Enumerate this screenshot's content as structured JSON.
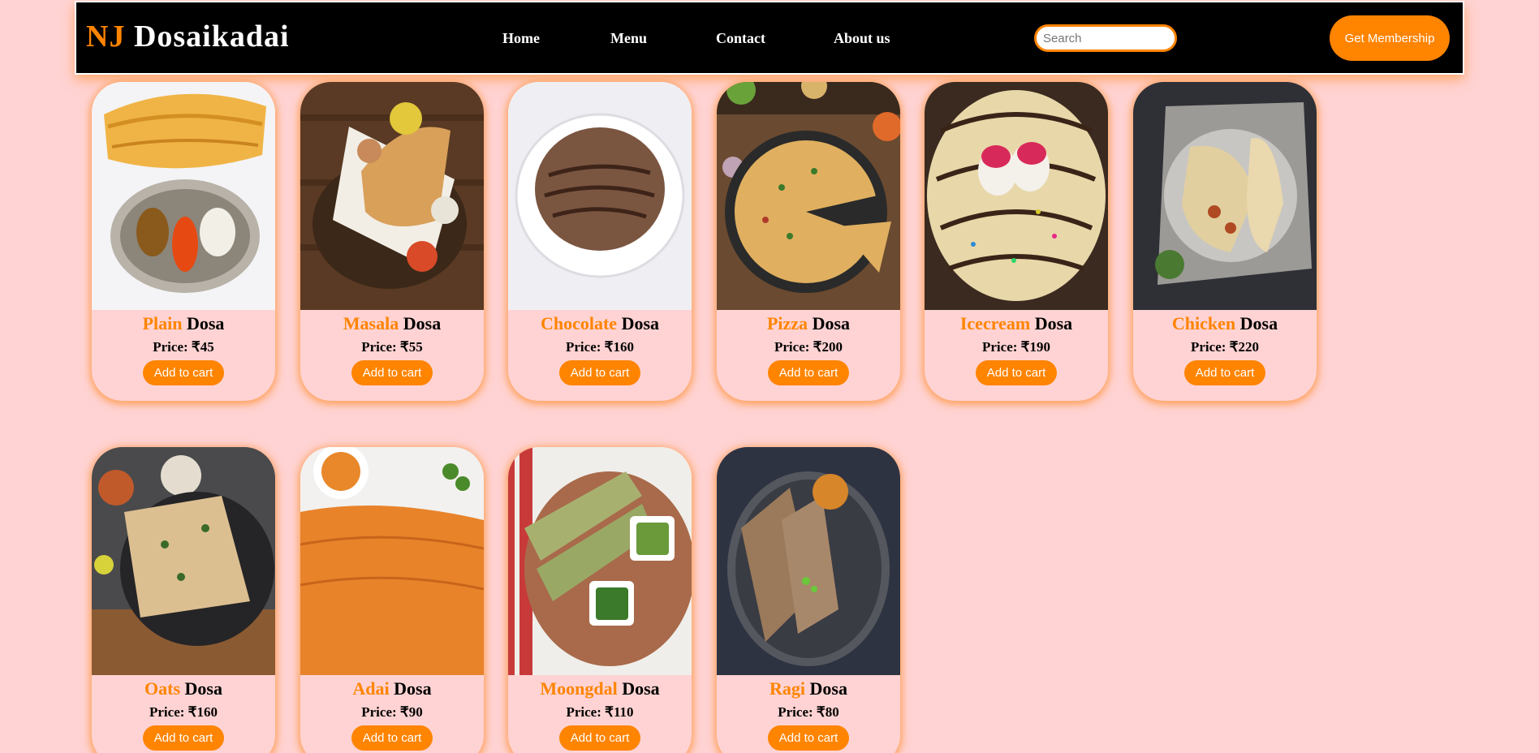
{
  "brand": {
    "prefix": "NJ",
    "name": "Dosaikadai"
  },
  "nav": {
    "home": "Home",
    "menu": "Menu",
    "contact": "Contact",
    "about": "About us"
  },
  "search": {
    "placeholder": "Search",
    "value": ""
  },
  "membership_label": "Get Membership",
  "colors": {
    "accent": "#ff8400",
    "background": "#ffd3d3",
    "navbar": "#000000"
  },
  "cards": [
    {
      "name": "Plain",
      "suffix": "Dosa",
      "price": "Price: ₹45",
      "button": "Add to cart"
    },
    {
      "name": "Masala",
      "suffix": "Dosa",
      "price": "Price: ₹55",
      "button": "Add to cart"
    },
    {
      "name": "Chocolate",
      "suffix": "Dosa",
      "price": "Price: ₹160",
      "button": "Add to cart"
    },
    {
      "name": "Pizza",
      "suffix": "Dosa",
      "price": "Price: ₹200",
      "button": "Add to cart"
    },
    {
      "name": "Icecream",
      "suffix": "Dosa",
      "price": "Price: ₹190",
      "button": "Add to cart"
    },
    {
      "name": "Chicken",
      "suffix": "Dosa",
      "price": "Price: ₹220",
      "button": "Add to cart"
    },
    {
      "name": "Oats",
      "suffix": "Dosa",
      "price": "Price: ₹160",
      "button": "Add to cart"
    },
    {
      "name": "Adai",
      "suffix": "Dosa",
      "price": "Price: ₹90",
      "button": "Add to cart"
    },
    {
      "name": "Moongdal",
      "suffix": "Dosa",
      "price": "Price: ₹110",
      "button": "Add to cart"
    },
    {
      "name": "Ragi",
      "suffix": "Dosa",
      "price": "Price: ₹80",
      "button": "Add to cart"
    }
  ]
}
